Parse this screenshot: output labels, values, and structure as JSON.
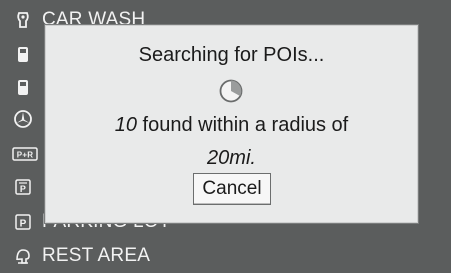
{
  "poi_list": {
    "items": [
      {
        "label": "CAR WASH",
        "icon": "car-wash-icon"
      },
      {
        "label": "",
        "icon": "fuel-icon"
      },
      {
        "label": "",
        "icon": "fuel-icon"
      },
      {
        "label": "",
        "icon": "mercedes-icon"
      },
      {
        "label": "",
        "icon": "park-and-ride-icon"
      },
      {
        "label": "",
        "icon": "parking-garage-icon"
      },
      {
        "label": "PARKING LOT",
        "icon": "parking-icon"
      },
      {
        "label": "REST AREA",
        "icon": "rest-area-icon"
      }
    ]
  },
  "dialog": {
    "title": "Searching for POIs...",
    "count": "10",
    "found_text": " found within a radius of",
    "radius": "20mi.",
    "cancel_label": "Cancel"
  },
  "colors": {
    "background": "#5b5d5d",
    "dialog_bg": "#e9eaea",
    "text_light": "#f2f2f2"
  }
}
